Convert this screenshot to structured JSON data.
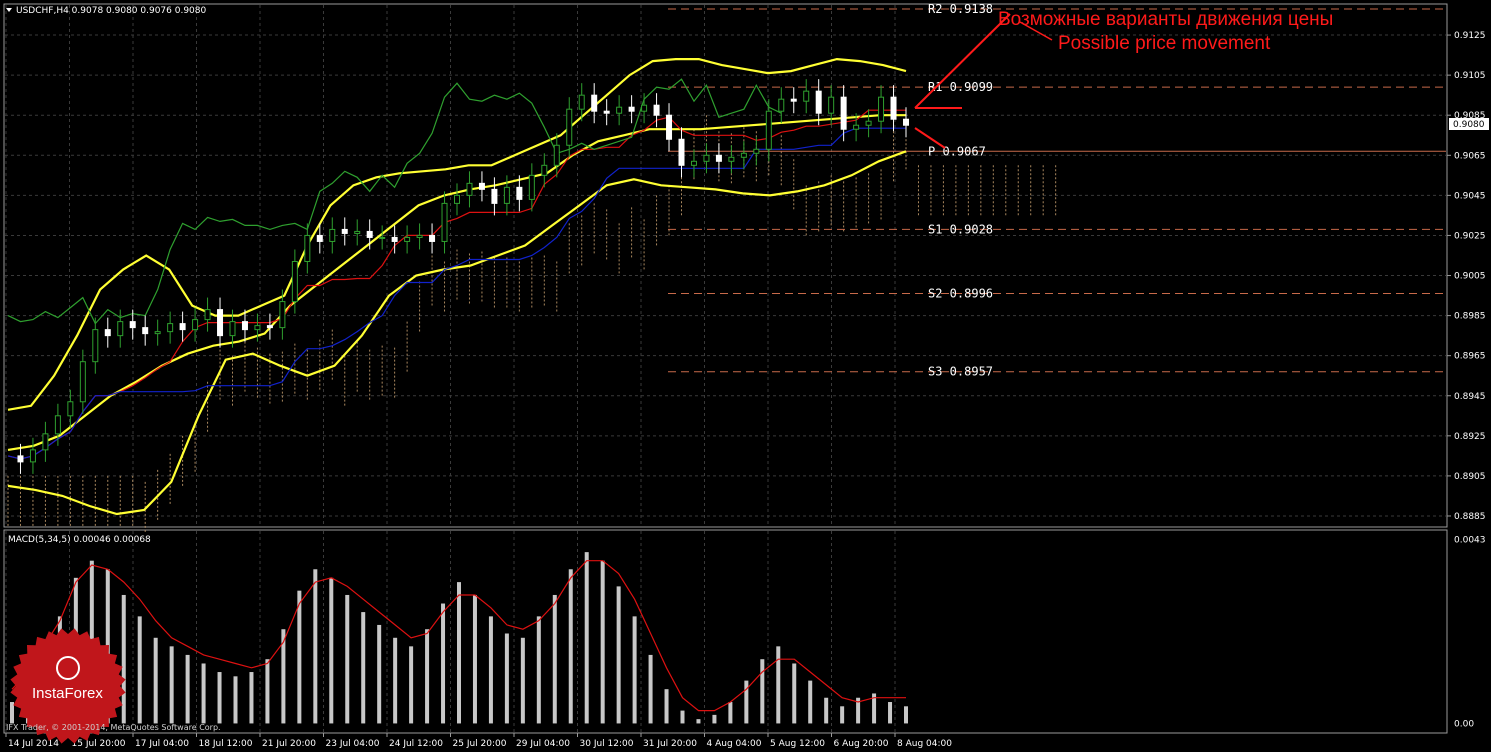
{
  "header": {
    "symbol_line": "USDCHF,H4  0.9078 0.9080 0.9076 0.9080"
  },
  "macd_header": "MACD(5,34,5) 0.00046 0.00068",
  "copyright": "IFX Trader, © 2001-2014, MetaQuotes Software Corp.",
  "logo": {
    "text": "InstaForex"
  },
  "annotation": {
    "line_ru": "Возможные варианты движения цены",
    "line_en": "Possible price movement"
  },
  "current_price": "0.9080",
  "colors": {
    "background": "#000000",
    "grid": "#3a3a3a",
    "bollinger": "#ffff33",
    "chikou": "#2fa02f",
    "tenkan": "#dd1111",
    "kijun": "#1122cc",
    "cloud": "#c8a070",
    "candle_bull": "#2fa02f",
    "candle_bear": "#ffffff",
    "macd_hist": "#c8c8c8",
    "macd_signal": "#dd1111",
    "pivot_line": "#c86a4a",
    "annotation": "#ff1a1a",
    "logo": "#c0161b"
  },
  "chart_data": {
    "type": "line",
    "symbol": "USDCHF",
    "timeframe": "H4",
    "ylim": [
      0.888,
      0.914
    ],
    "y_ticks": [
      "0.9125",
      "0.9105",
      "0.9085",
      "0.9065",
      "0.9045",
      "0.9025",
      "0.9005",
      "0.8985",
      "0.8965",
      "0.8945",
      "0.8925",
      "0.8905",
      "0.8885"
    ],
    "x_ticks": [
      "14 Jul 2014",
      "15 Jul 20:00",
      "17 Jul 04:00",
      "18 Jul 12:00",
      "21 Jul 20:00",
      "23 Jul 04:00",
      "24 Jul 12:00",
      "25 Jul 20:00",
      "29 Jul 04:00",
      "30 Jul 12:00",
      "31 Jul 20:00",
      "4 Aug 04:00",
      "5 Aug 12:00",
      "6 Aug 20:00",
      "8 Aug 04:00"
    ],
    "pivot_levels": [
      {
        "name": "R2",
        "value": 0.9138,
        "label": "R2  0.9138"
      },
      {
        "name": "R1",
        "value": 0.9099,
        "label": "R1  0.9099"
      },
      {
        "name": "P",
        "value": 0.9067,
        "label": "P  0.9067"
      },
      {
        "name": "S1",
        "value": 0.9028,
        "label": "S1  0.9028"
      },
      {
        "name": "S2",
        "value": 0.8996,
        "label": "S2  0.8996"
      },
      {
        "name": "S3",
        "value": 0.8957,
        "label": "S3  0.8957"
      }
    ],
    "closes": [
      0.8915,
      0.8912,
      0.8918,
      0.8926,
      0.8935,
      0.8942,
      0.8962,
      0.8978,
      0.8975,
      0.8982,
      0.8979,
      0.8976,
      0.8977,
      0.8981,
      0.8978,
      0.8983,
      0.8988,
      0.8975,
      0.8982,
      0.8978,
      0.898,
      0.8979,
      0.8992,
      0.9012,
      0.9025,
      0.9022,
      0.9028,
      0.9026,
      0.9027,
      0.9024,
      0.9024,
      0.9022,
      0.9024,
      0.9025,
      0.9022,
      0.9041,
      0.9045,
      0.9051,
      0.9048,
      0.9041,
      0.9049,
      0.9043,
      0.9055,
      0.906,
      0.907,
      0.9088,
      0.9095,
      0.9087,
      0.9086,
      0.9089,
      0.9087,
      0.909,
      0.9085,
      0.9073,
      0.906,
      0.9062,
      0.9065,
      0.9062,
      0.9064,
      0.9066,
      0.9068,
      0.9087,
      0.9093,
      0.9092,
      0.9097,
      0.9086,
      0.9094,
      0.9078,
      0.908,
      0.9082,
      0.9094,
      0.9083,
      0.908
    ],
    "bollinger": {
      "upper": [
        0.8938,
        0.894,
        0.8955,
        0.8975,
        0.8998,
        0.9008,
        0.9015,
        0.9008,
        0.899,
        0.8985,
        0.8985,
        0.899,
        0.8995,
        0.902,
        0.904,
        0.905,
        0.9054,
        0.9056,
        0.9057,
        0.9058,
        0.906,
        0.906,
        0.9065,
        0.907,
        0.9075,
        0.9085,
        0.9095,
        0.9105,
        0.9112,
        0.9113,
        0.9113,
        0.911,
        0.9108,
        0.9106,
        0.9107,
        0.911,
        0.9113,
        0.9112,
        0.911,
        0.9107
      ],
      "middle": [
        0.8918,
        0.892,
        0.8925,
        0.8935,
        0.8945,
        0.8952,
        0.896,
        0.8966,
        0.897,
        0.8972,
        0.8976,
        0.899,
        0.9,
        0.901,
        0.902,
        0.903,
        0.904,
        0.9045,
        0.9048,
        0.905,
        0.9053,
        0.9056,
        0.9065,
        0.9072,
        0.9075,
        0.9078,
        0.9078,
        0.9078,
        0.9079,
        0.908,
        0.9081,
        0.9082,
        0.9083,
        0.9084,
        0.9085,
        0.9085
      ],
      "lower": [
        0.89,
        0.8898,
        0.8895,
        0.889,
        0.8886,
        0.8888,
        0.8902,
        0.8935,
        0.8963,
        0.8966,
        0.896,
        0.8955,
        0.896,
        0.8975,
        0.8995,
        0.9005,
        0.9008,
        0.901,
        0.9015,
        0.902,
        0.903,
        0.904,
        0.905,
        0.9053,
        0.905,
        0.9049,
        0.9048,
        0.9046,
        0.9045,
        0.9047,
        0.905,
        0.9055,
        0.9062,
        0.9067
      ]
    },
    "macd": {
      "histogram": [
        0.0005,
        0.0012,
        0.0018,
        0.0025,
        0.0034,
        0.0038,
        0.0036,
        0.003,
        0.0025,
        0.002,
        0.0018,
        0.0016,
        0.0014,
        0.0012,
        0.0011,
        0.0012,
        0.0015,
        0.0022,
        0.0031,
        0.0036,
        0.0034,
        0.003,
        0.0026,
        0.0023,
        0.002,
        0.0018,
        0.0022,
        0.0028,
        0.0033,
        0.003,
        0.0025,
        0.0021,
        0.002,
        0.0025,
        0.003,
        0.0036,
        0.004,
        0.0038,
        0.0032,
        0.0025,
        0.0016,
        0.0008,
        0.0003,
        0.0001,
        0.0002,
        0.0005,
        0.001,
        0.0015,
        0.0018,
        0.0014,
        0.001,
        0.0006,
        0.0004,
        0.0006,
        0.0007,
        0.0005,
        0.0004
      ],
      "signal": [
        0.0008,
        0.0012,
        0.0018,
        0.0024,
        0.0033,
        0.0037,
        0.0036,
        0.0033,
        0.0029,
        0.0024,
        0.002,
        0.0018,
        0.0016,
        0.0015,
        0.0014,
        0.0013,
        0.0014,
        0.0019,
        0.0028,
        0.0033,
        0.0034,
        0.0032,
        0.0029,
        0.0026,
        0.0023,
        0.002,
        0.0021,
        0.0026,
        0.003,
        0.003,
        0.0027,
        0.0023,
        0.0022,
        0.0024,
        0.0028,
        0.0034,
        0.0038,
        0.0038,
        0.0035,
        0.0029,
        0.0021,
        0.0013,
        0.0006,
        0.0003,
        0.0003,
        0.0005,
        0.0008,
        0.0012,
        0.0015,
        0.0015,
        0.0012,
        0.0009,
        0.0006,
        0.0005,
        0.0006,
        0.0006,
        0.0006
      ],
      "y_ticks": [
        "0.0043",
        "0.00"
      ],
      "ylim": [
        -0.0002,
        0.0044
      ]
    }
  }
}
